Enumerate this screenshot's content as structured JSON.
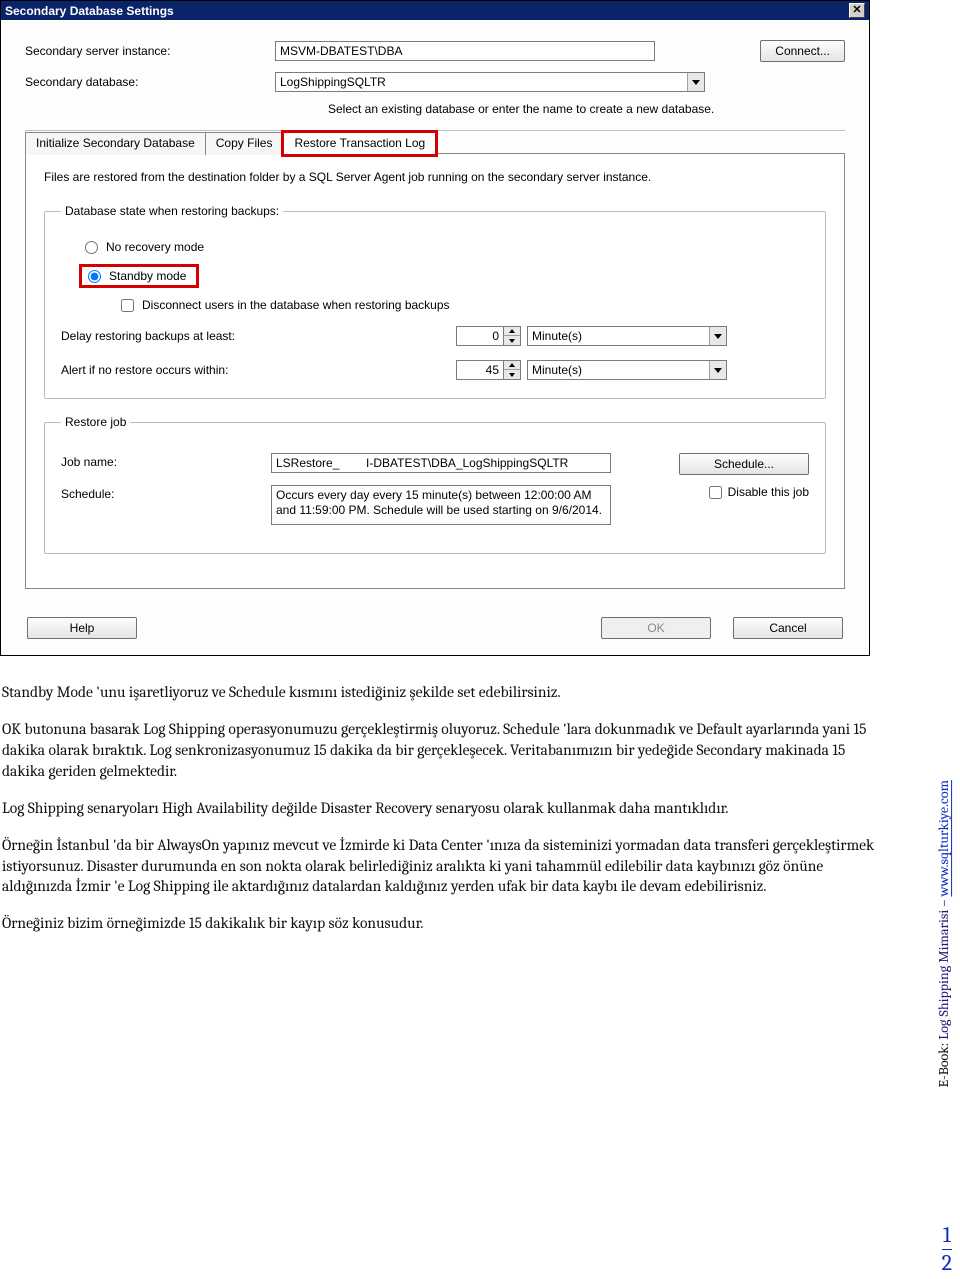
{
  "dialog": {
    "title": "Secondary Database Settings",
    "server_instance_label": "Secondary server instance:",
    "server_instance_value": "MSVM-DBATEST\\DBA",
    "connect_btn": "Connect...",
    "secondary_db_label": "Secondary database:",
    "secondary_db_value": "LogShippingSQLTR",
    "hint": "Select an existing database or enter the name to create a new database.",
    "tabs": {
      "init": "Initialize Secondary Database",
      "copy": "Copy Files",
      "restore": "Restore Transaction Log"
    },
    "panel": {
      "desc": "Files are restored from the destination folder by a SQL Server Agent job running on the secondary server instance.",
      "state_legend": "Database state when restoring backups:",
      "no_recovery": "No recovery mode",
      "standby": "Standby mode",
      "disconnect_users": "Disconnect users in the database when restoring backups",
      "delay_label": "Delay restoring backups at least:",
      "delay_value": "0",
      "delay_unit": "Minute(s)",
      "alert_label": "Alert if no restore occurs within:",
      "alert_value": "45",
      "alert_unit": "Minute(s)",
      "restore_legend": "Restore job",
      "jobname_label": "Job name:",
      "jobname_value": "LSRestore_        I-DBATEST\\DBA_LogShippingSQLTR",
      "schedule_btn": "Schedule...",
      "schedule_label": "Schedule:",
      "schedule_text": "Occurs every day every 15 minute(s) between 12:00:00 AM and 11:59:00 PM. Schedule will be used starting on 9/6/2014.",
      "disable_job": "Disable this job"
    },
    "footer": {
      "help": "Help",
      "ok": "OK",
      "cancel": "Cancel"
    }
  },
  "article": {
    "p1": "Standby Mode 'unu işaretliyoruz ve Schedule kısmını istediğiniz şekilde set edebilirsiniz.",
    "p2": "OK butonuna basarak Log Shipping operasyonumuzu gerçekleştirmiş oluyoruz. Schedule 'lara dokunmadık ve Default ayarlarında yani 15 dakika olarak bıraktık. Log senkronizasyonumuz 15 dakika da bir gerçekleşecek. Veritabanımızın bir yedeğide Secondary makinada 15 dakika geriden gelmektedir.",
    "p3": "Log Shipping senaryoları High Availability değilde Disaster Recovery senaryosu olarak kullanmak daha mantıklıdır.",
    "p4": "Örneğin İstanbul 'da bir AlwaysOn yapınız mevcut ve İzmirde ki Data Center 'ınıza da sisteminizi yormadan data transferi gerçekleştirmek istiyorsunuz. Disaster durumunda en son nokta olarak belirlediğiniz aralıkta ki yani tahammül edilebilir data kaybınızı göz önüne aldığınızda İzmir 'e Log Shipping ile aktardığınız datalardan kaldığınız yerden ufak bir data kaybı ile devam edebilirisniz.",
    "p5": "Örneğiniz bizim örneğimizde 15 dakikalık bir kayıp söz konusudur."
  },
  "side": {
    "prefix": "E-Book: ",
    "title": "Log Shipping Mimarisi – ",
    "url": "www.sqlturkiye.com"
  },
  "page_numbers": {
    "top": "1",
    "bottom": "2"
  }
}
